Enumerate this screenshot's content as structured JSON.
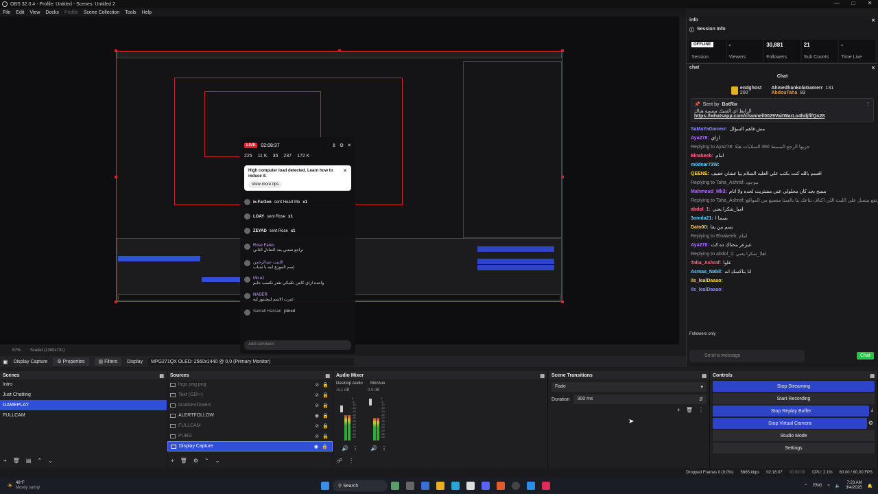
{
  "window": {
    "title": "OBS 32.0.4 - Profile: Untitled - Scenes: Untitled 2"
  },
  "menu": [
    "File",
    "Edit",
    "View",
    "Docks",
    "Profile",
    "Scene Collection",
    "Tools",
    "Help"
  ],
  "menu_disabled": [
    "Profile"
  ],
  "preview": {
    "live_badge": "LIVE",
    "live_time": "02:08:37",
    "stats": [
      "225",
      "11 K",
      "35",
      "237",
      "172 K"
    ],
    "notice_title": "High computer load detected. Learn how to reduce it.",
    "notice_button": "View more tips",
    "gifts": [
      {
        "user": "ix.Far3on",
        "text": "sent Heart Me",
        "count": "x1"
      },
      {
        "user": "LOAY",
        "text": "sent Rose",
        "count": "x1"
      },
      {
        "user": "ZEYAD",
        "text": "sent Rose",
        "count": "x1"
      }
    ],
    "comments": [
      {
        "user": "Rose Fares",
        "text": "تراجع شعبي بعد التعادل الثاني"
      },
      {
        "user": "اللتيب عبدالرحمن",
        "text": "إسم الموزع انيه يا شباب"
      },
      {
        "user": "Mo ez",
        "text": "واحدة ازاي كابتن تكتيكي تقدر تكسب جايم"
      },
      {
        "user": "NADER",
        "text": "غيرت الاسم لتيجيتور ليه"
      },
      {
        "user": "Samah Hassan",
        "text": "joined"
      }
    ],
    "comment_placeholder": "Add comment",
    "zoom": "67%",
    "scaled": "Scaled (1300x731)"
  },
  "source_bar": {
    "source": "Display Capture",
    "properties": "Properties",
    "filters": "Filters",
    "display_label": "Display",
    "display_value": "MPG271QX OLED: 2560x1440 @ 0,0 (Primary Monitor)"
  },
  "scenes": {
    "title": "Scenes",
    "items": [
      "Intro",
      "Just Chatting",
      "GAMEPLAY",
      "FULLCAM"
    ],
    "selected": 2
  },
  "sources": {
    "title": "Sources",
    "items": [
      {
        "name": "logo png.png",
        "dim": true
      },
      {
        "name": "Text (GDI+)",
        "dim": true
      },
      {
        "name": "GoalsFollowers",
        "dim": true
      },
      {
        "name": "ALERTFOLLOW",
        "dim": false
      },
      {
        "name": "FULLCAM",
        "dim": true
      },
      {
        "name": "PUBG",
        "dim": true
      },
      {
        "name": "Display Capture",
        "dim": false,
        "selected": true
      }
    ]
  },
  "audio": {
    "title": "Audio Mixer",
    "channels": [
      {
        "name": "Desktop Audio",
        "db": "-5.1 dB",
        "level": 0.62
      },
      {
        "name": "Mic/Aux",
        "db": "0.0 dB",
        "level": 0.55
      }
    ]
  },
  "meter_ticks": [
    "0",
    "-5",
    "-10",
    "-15",
    "-20",
    "-25",
    "-30",
    "-35",
    "-40",
    "-45",
    "-50",
    "-55",
    "-60"
  ],
  "transitions": {
    "title": "Scene Transitions",
    "selected": "Fade",
    "duration_label": "Duration",
    "duration": "300 ms"
  },
  "controls": {
    "title": "Controls",
    "buttons": [
      {
        "label": "Stop Streaming",
        "active": true
      },
      {
        "label": "Start Recording",
        "active": false
      },
      {
        "label": "Stop Replay Buffer",
        "active": true
      },
      {
        "label": "Stop Virtual Camera",
        "active": true
      },
      {
        "label": "Studio Mode",
        "active": false
      },
      {
        "label": "Settings",
        "active": false
      }
    ]
  },
  "info_dock": {
    "title": "info",
    "session_title": "Session Info",
    "cells": [
      {
        "value": "OFFLINE",
        "label": "Session"
      },
      {
        "value": "-",
        "label": "Viewers"
      },
      {
        "value": "30,881",
        "label": "Followers"
      },
      {
        "value": "21",
        "label": "Sub Counts"
      },
      {
        "value": "-",
        "label": "Time Live"
      }
    ]
  },
  "chat_dock": {
    "title": "chat",
    "header": "Chat",
    "leader1": {
      "name": "endghost",
      "points": "200"
    },
    "leader2": {
      "name": "AhmedhankolaGamerr",
      "points": "131"
    },
    "leader3": {
      "name": "AbdouTaha",
      "points": "83"
    },
    "pinned_by": "Sent by",
    "pinned_user": "BotRix",
    "pinned_text": "الرابط اي الشيك منسية هناك",
    "pinned_link": "https://whatsapp.com/channel/0029VaitWarLo4hdjfifQn28",
    "messages": [
      {
        "user": "SaMaYaGamerr:",
        "text": "مش فاهم السؤال",
        "reply": ""
      },
      {
        "user": "Aya278:",
        "text": "ازاي",
        "reply": ""
      },
      {
        "user": "",
        "text": "",
        "reply": "Replying to Aya278: جربها الرجع البسيط 360 السلايات هتلا"
      },
      {
        "user": "Elnakeeb:",
        "text": "امام",
        "reply": ""
      },
      {
        "user": "m0dnar73W:",
        "text": "",
        "reply": ""
      },
      {
        "user": "QEENE:",
        "text": "اقسم بالله كنت بكتب علي العليه السلام بيا عشان خفيف",
        "reply": ""
      },
      {
        "user": "",
        "text": "",
        "reply": "Replying to Taha_Ashraf: موجود"
      },
      {
        "user": "Mahmoud_Mk3:",
        "text": "مسح بجد كان محلولي عني مشتريت لحده ولا انام",
        "reply": ""
      },
      {
        "user": "",
        "text": "",
        "reply": "Replying to Taha_Ashraf: برتفع بيتسل علي اللبت اللي اكتاف بتاعك بتا بالسنا منضيع من المواقع"
      },
      {
        "user": "abdol_1:",
        "text": "امبا_شكرا يعني",
        "reply": ""
      },
      {
        "user": "3omda21:",
        "text": "بسما ا",
        "reply": ""
      },
      {
        "user": "Dato00:",
        "text": "نسم من بقا",
        "reply": ""
      },
      {
        "user": "",
        "text": "",
        "reply": "Replying to Elnakeeb: امام"
      },
      {
        "user": "Aya278:",
        "text": "عيزعر محتاك ذه كت",
        "reply": ""
      },
      {
        "user": "",
        "text": "",
        "reply": "Replying to abdol_1: اهلا_شكرا يعني"
      },
      {
        "user": "Taha_Ashraf:",
        "text": "علوا",
        "reply": ""
      },
      {
        "user": "Asmaa_Nabil:",
        "text": "انا بتاكسك انه",
        "reply": ""
      },
      {
        "user": "ils_lealDaaao:",
        "text": "",
        "reply": ""
      },
      {
        "user": "ils_lealDaaao:",
        "text": "",
        "reply": ""
      }
    ],
    "followers_only": "Followers only",
    "placeholder": "Send a message",
    "send": "Chat"
  },
  "status_bar": {
    "dropped": "Dropped Frames 0 (0.0%)",
    "kbps": "5665 kbps",
    "stream_time": "02:16:07",
    "rec_time": "00:00:00",
    "cpu": "CPU: 2.1%",
    "fps": "60.00 / 60.00 FPS"
  },
  "taskbar": {
    "weather_temp": "48°F",
    "weather_desc": "Mostly sunny",
    "search": "Search",
    "lang": "ENG",
    "time": "7:23 AM",
    "date": "3/4/2026"
  },
  "colors": {
    "accent": "#2f4fd8",
    "live": "#e0202a",
    "chat_green": "#29c24a"
  }
}
